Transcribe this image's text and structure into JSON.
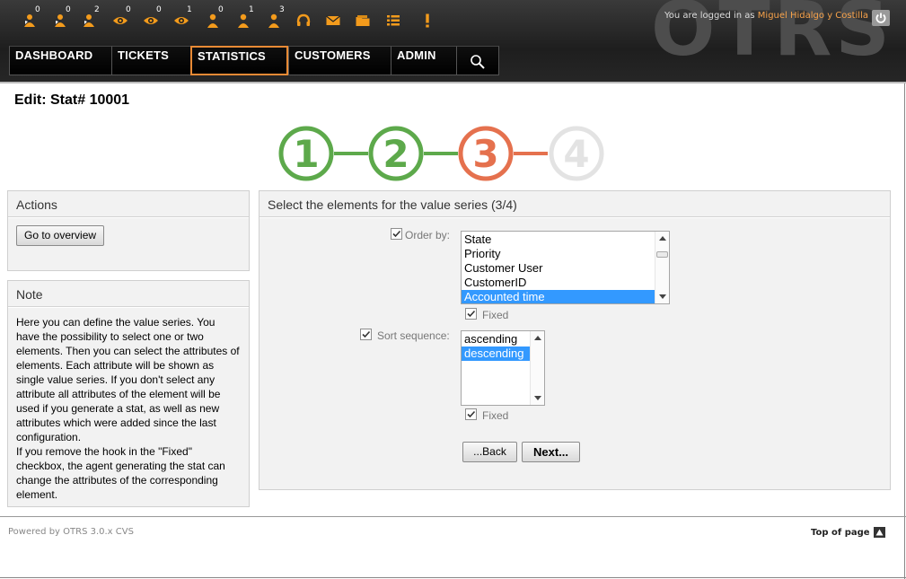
{
  "header": {
    "watermark": "OTRS",
    "login_prefix": "You are logged in as",
    "user_name": "Miguel Hidalgo y Costilla",
    "toolbar": [
      {
        "icon": "locked-tickets-new-icon",
        "count": "0"
      },
      {
        "icon": "locked-tickets-reminder-icon",
        "count": "0"
      },
      {
        "icon": "locked-tickets-total-icon",
        "count": "2"
      },
      {
        "icon": "watched-tickets-new-icon",
        "count": "0"
      },
      {
        "icon": "watched-tickets-reminder-icon",
        "count": "0"
      },
      {
        "icon": "watched-tickets-total-icon",
        "count": "1"
      },
      {
        "icon": "responsible-tickets-new-icon",
        "count": "0"
      },
      {
        "icon": "responsible-tickets-reminder-icon",
        "count": "1"
      },
      {
        "icon": "responsible-tickets-total-icon",
        "count": "3"
      },
      {
        "icon": "phone-ticket-icon",
        "count": ""
      },
      {
        "icon": "email-ticket-icon",
        "count": ""
      },
      {
        "icon": "queue-view-icon",
        "count": ""
      },
      {
        "icon": "status-view-icon",
        "count": ""
      },
      {
        "icon": "escalation-view-icon",
        "count": ""
      }
    ]
  },
  "nav": [
    {
      "label": "DASHBOARD",
      "active": false
    },
    {
      "label": "TICKETS",
      "active": false
    },
    {
      "label": "STATISTICS",
      "active": true
    },
    {
      "label": "CUSTOMERS",
      "active": false
    },
    {
      "label": "ADMIN",
      "active": false
    }
  ],
  "page_title": "Edit: Stat# 10001",
  "steps": {
    "labels": [
      "1",
      "2",
      "3",
      "4"
    ],
    "current": 3,
    "colors": {
      "done": "#5da94b",
      "current": "#e5714e",
      "todo": "#e3e3e3"
    }
  },
  "actions": {
    "title": "Actions",
    "overview_button": "Go to overview"
  },
  "note": {
    "title": "Note",
    "paragraph1": "Here you can define the value series. You have the possibility to select one or two elements. Then you can select the attributes of elements. Each attribute will be shown as single value series. If you don't select any attribute all attributes of the element will be used if you generate a stat, as well as new attributes which were added since the last configuration.",
    "paragraph2": "If you remove the hook in the \"Fixed\" checkbox, the agent generating the stat can change the attributes of the corresponding element."
  },
  "main": {
    "title": "Select the elements for the value series (3/4)",
    "order_by": {
      "label": "Order by:",
      "checked": true,
      "options": [
        "State",
        "Priority",
        "Customer User",
        "CustomerID",
        "Accounted time"
      ],
      "selected": "Accounted time",
      "fixed_label": "Fixed",
      "fixed_checked": true
    },
    "sort_sequence": {
      "label": "Sort sequence:",
      "checked": true,
      "options": [
        "ascending",
        "descending"
      ],
      "selected": "descending",
      "fixed_label": "Fixed",
      "fixed_checked": true
    },
    "back_button": "...Back",
    "next_button": "Next..."
  },
  "footer": {
    "powered_by": "Powered by OTRS 3.0.x CVS",
    "top_of_page": "Top of page"
  }
}
